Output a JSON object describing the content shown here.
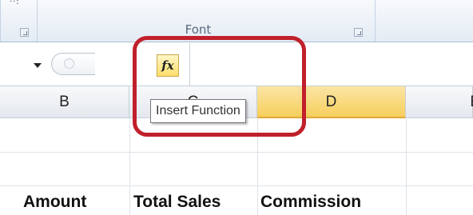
{
  "ribbon": {
    "group_label": "Font",
    "partial_text": "··:"
  },
  "formula_bar": {
    "fx_label": "fx",
    "formula_value": ""
  },
  "columns": [
    {
      "label": "B",
      "active": false
    },
    {
      "label": "C",
      "active": false
    },
    {
      "label": "D",
      "active": true
    },
    {
      "label": "E",
      "active": false
    }
  ],
  "tooltip": {
    "text": "Insert Function"
  },
  "row_headers": {
    "amount": "Amount",
    "total_sales": "Total Sales",
    "commission": "Commission"
  },
  "colors": {
    "highlight": "#c0202b",
    "active_column": "#f7cf5d"
  }
}
